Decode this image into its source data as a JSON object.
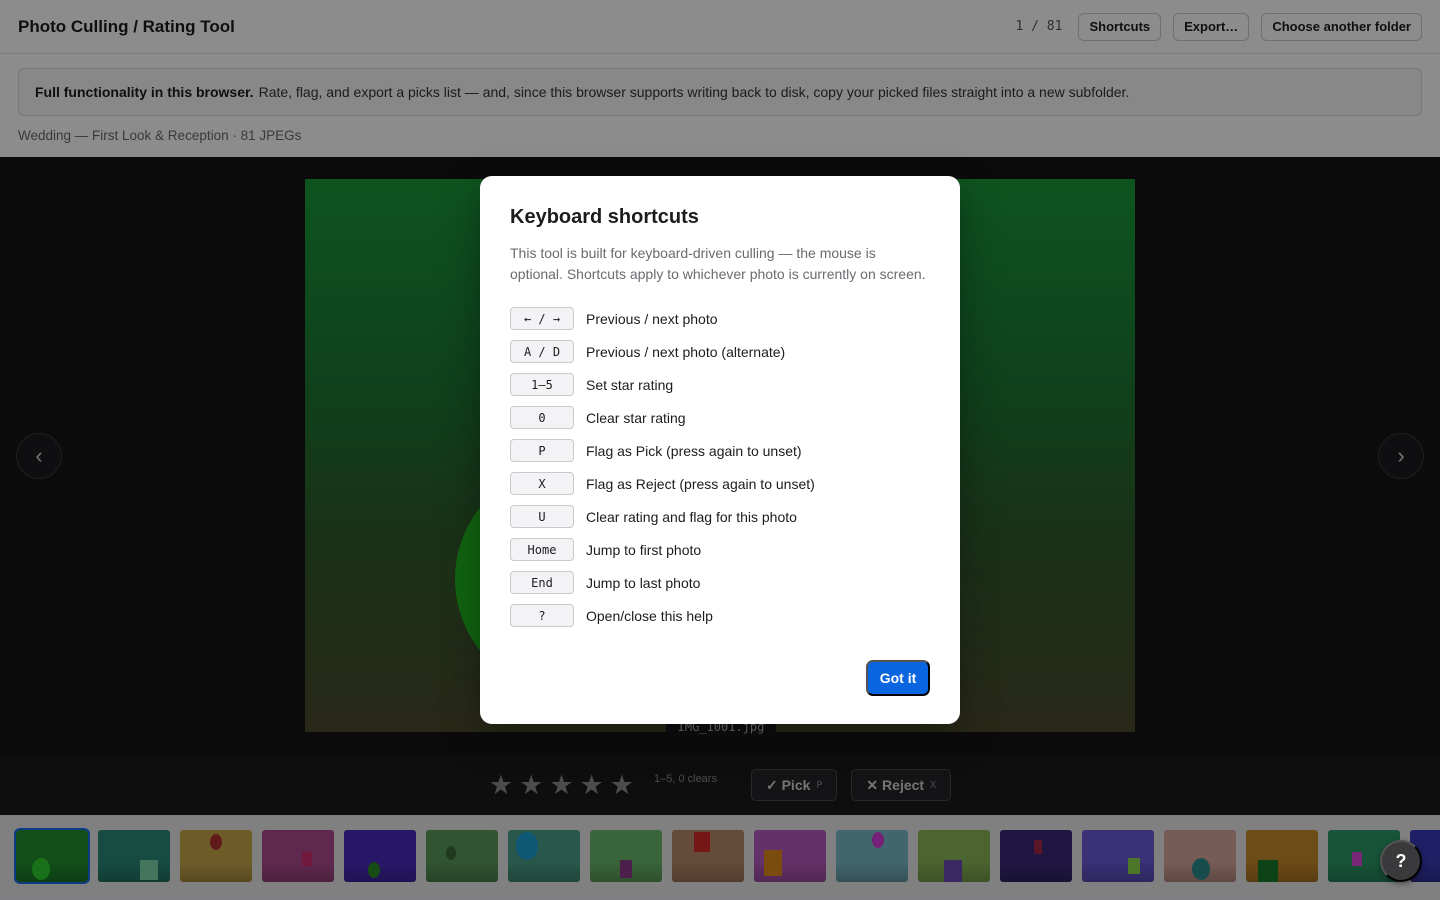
{
  "header": {
    "title": "Photo Culling / Rating Tool",
    "counter": "1 / 81",
    "shortcuts_label": "Shortcuts",
    "export_label": "Export…",
    "choose_folder_label": "Choose another folder"
  },
  "notice": {
    "bold": "Full functionality in this browser.",
    "text": "Rate, flag, and export a picks list — and, since this browser supports writing back to disk, copy your picked files straight into a new subfolder."
  },
  "collection": {
    "label": "Wedding — First Look & Reception · 81 JPEGs"
  },
  "viewer": {
    "filename": "IMG_1001.jpg",
    "prev_icon": "‹",
    "next_icon": "›"
  },
  "rating": {
    "star_glyph": "★",
    "hint": "1–5, 0 clears",
    "pick_label": "✓ Pick",
    "pick_key": "P",
    "reject_label": "✕ Reject",
    "reject_key": "X"
  },
  "filmstrip": {
    "colors": [
      "#1f8f2f",
      "#2a8a78",
      "#c9a84a",
      "#b04a90",
      "#4a2bbf",
      "#5a9a5a",
      "#4aa08a",
      "#6ab86a",
      "#b88a6a",
      "#b85abf",
      "#7ab8c8",
      "#8ab858",
      "#3a2a78",
      "#6a5ad8",
      "#d8a89a",
      "#c88a2a",
      "#2a9a6a",
      "#3a3ab8"
    ],
    "selected_index": 0
  },
  "help_fab": {
    "label": "?"
  },
  "modal": {
    "title": "Keyboard shortcuts",
    "description": "This tool is built for keyboard-driven culling — the mouse is optional. Shortcuts apply to whichever photo is currently on screen.",
    "shortcuts": [
      {
        "key": "← / →",
        "desc": "Previous / next photo"
      },
      {
        "key": "A / D",
        "desc": "Previous / next photo (alternate)"
      },
      {
        "key": "1–5",
        "desc": "Set star rating"
      },
      {
        "key": "0",
        "desc": "Clear star rating"
      },
      {
        "key": "P",
        "desc": "Flag as Pick (press again to unset)"
      },
      {
        "key": "X",
        "desc": "Flag as Reject (press again to unset)"
      },
      {
        "key": "U",
        "desc": "Clear rating and flag for this photo"
      },
      {
        "key": "Home",
        "desc": "Jump to first photo"
      },
      {
        "key": "End",
        "desc": "Jump to last photo"
      },
      {
        "key": "?",
        "desc": "Open/close this help"
      }
    ],
    "confirm_label": "Got it"
  }
}
